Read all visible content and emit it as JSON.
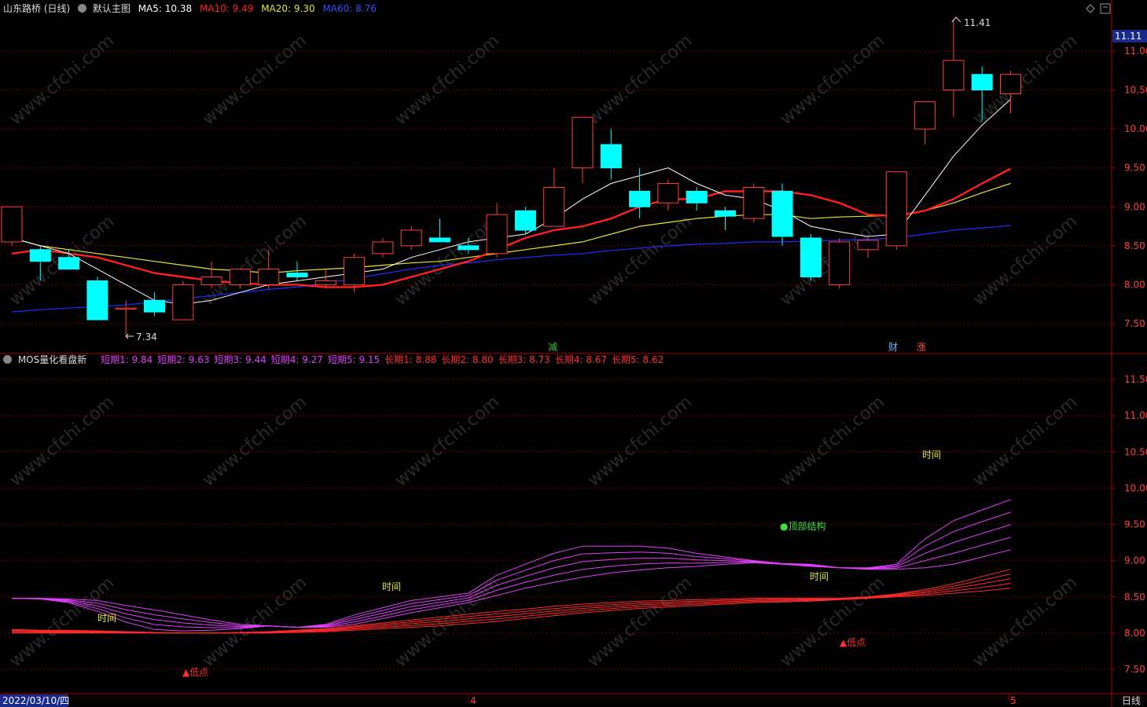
{
  "main_header": {
    "stock": "山东路桥 (日线)",
    "template": "默认主图",
    "ma5": "MA5: 10.38",
    "ma10": "MA10: 9.49",
    "ma20": "MA20: 9.30",
    "ma60": "MA60: 8.76"
  },
  "sub_header": {
    "title": "MOS量化看盘新",
    "values": [
      {
        "text": "短期1: 9.84",
        "color": "#e040fb"
      },
      {
        "text": "短期2: 9.63",
        "color": "#e040fb"
      },
      {
        "text": "短期3: 9.44",
        "color": "#e040fb"
      },
      {
        "text": "短期4: 9.27",
        "color": "#e040fb"
      },
      {
        "text": "短期5: 9.15",
        "color": "#e040fb"
      },
      {
        "text": "长期1: 8.88",
        "color": "#ff3030"
      },
      {
        "text": "长期2: 8.80",
        "color": "#ff3030"
      },
      {
        "text": "长期3: 8.73",
        "color": "#ff3030"
      },
      {
        "text": "长期4: 8.67",
        "color": "#ff3030"
      },
      {
        "text": "长期5: 8.62",
        "color": "#ff3030"
      }
    ]
  },
  "price_axis": {
    "current": "11.11",
    "ticks": [
      "11.00",
      "10.50",
      "10.00",
      "9.50",
      "9.00",
      "8.50",
      "8.00",
      "7.50"
    ]
  },
  "indicator_axis": {
    "ticks": [
      "11.50",
      "11.00",
      "10.50",
      "10.00",
      "9.50",
      "9.00",
      "8.50",
      "8.00",
      "7.50"
    ]
  },
  "annotations": {
    "high": "11.41",
    "low": "7.34",
    "jian": "减",
    "cai": "财",
    "zhang": "涨",
    "time_labels": [
      "时间",
      "时间",
      "时间",
      "时间"
    ],
    "top_structure": "●顶部结构",
    "low_point": "▲低点"
  },
  "x_axis": {
    "date": "2022/03/10/四",
    "month4": "4",
    "month5": "5",
    "period": "日线"
  },
  "watermark": "www.cfchi.com",
  "colors": {
    "up": "#ff4040",
    "down": "#00ffff",
    "ma5": "#ffffff",
    "ma10": "#ff2020",
    "ma20": "#e6e633",
    "ma60": "#2030ff",
    "short": "#e040fb",
    "long": "#ff2a2a",
    "grid": "#7a0000",
    "axis": "#b00000"
  },
  "chart_data": {
    "type": "candlestick",
    "price_range": [
      7.1,
      11.4
    ],
    "indicator_range": [
      7.25,
      11.85
    ],
    "candles": [
      {
        "o": 8.55,
        "h": 9.0,
        "l": 8.5,
        "c": 9.0
      },
      {
        "o": 8.45,
        "h": 8.5,
        "l": 8.05,
        "c": 8.3
      },
      {
        "o": 8.35,
        "h": 8.45,
        "l": 8.25,
        "c": 8.2
      },
      {
        "o": 8.05,
        "h": 8.1,
        "l": 7.55,
        "c": 7.55
      },
      {
        "o": 7.7,
        "h": 7.8,
        "l": 7.34,
        "c": 7.7
      },
      {
        "o": 7.8,
        "h": 7.9,
        "l": 7.6,
        "c": 7.65
      },
      {
        "o": 7.55,
        "h": 8.05,
        "l": 7.55,
        "c": 8.0
      },
      {
        "o": 8.0,
        "h": 8.3,
        "l": 7.95,
        "c": 8.1
      },
      {
        "o": 8.0,
        "h": 8.2,
        "l": 7.95,
        "c": 8.2
      },
      {
        "o": 8.0,
        "h": 8.45,
        "l": 7.95,
        "c": 8.2
      },
      {
        "o": 8.15,
        "h": 8.3,
        "l": 8.05,
        "c": 8.1
      },
      {
        "o": 8.0,
        "h": 8.2,
        "l": 7.95,
        "c": 8.05
      },
      {
        "o": 8.0,
        "h": 8.4,
        "l": 7.9,
        "c": 8.35
      },
      {
        "o": 8.4,
        "h": 8.6,
        "l": 8.35,
        "c": 8.55
      },
      {
        "o": 8.5,
        "h": 8.75,
        "l": 8.45,
        "c": 8.7
      },
      {
        "o": 8.6,
        "h": 8.85,
        "l": 8.55,
        "c": 8.55
      },
      {
        "o": 8.5,
        "h": 8.6,
        "l": 8.4,
        "c": 8.45
      },
      {
        "o": 8.4,
        "h": 9.05,
        "l": 8.35,
        "c": 8.9
      },
      {
        "o": 8.95,
        "h": 9.0,
        "l": 8.65,
        "c": 8.7
      },
      {
        "o": 8.75,
        "h": 9.5,
        "l": 8.75,
        "c": 9.25
      },
      {
        "o": 9.5,
        "h": 10.15,
        "l": 9.3,
        "c": 10.15
      },
      {
        "o": 9.8,
        "h": 10.0,
        "l": 9.35,
        "c": 9.5
      },
      {
        "o": 9.2,
        "h": 9.5,
        "l": 8.85,
        "c": 9.0
      },
      {
        "o": 9.05,
        "h": 9.35,
        "l": 8.95,
        "c": 9.3
      },
      {
        "o": 9.2,
        "h": 9.25,
        "l": 8.95,
        "c": 9.05
      },
      {
        "o": 8.95,
        "h": 9.0,
        "l": 8.7,
        "c": 8.88
      },
      {
        "o": 8.85,
        "h": 9.3,
        "l": 8.8,
        "c": 9.25
      },
      {
        "o": 9.2,
        "h": 9.3,
        "l": 8.5,
        "c": 8.62
      },
      {
        "o": 8.6,
        "h": 8.65,
        "l": 8.05,
        "c": 8.1
      },
      {
        "o": 8.0,
        "h": 8.6,
        "l": 7.95,
        "c": 8.55
      },
      {
        "o": 8.45,
        "h": 8.6,
        "l": 8.35,
        "c": 8.57
      },
      {
        "o": 8.5,
        "h": 9.45,
        "l": 8.45,
        "c": 9.45
      },
      {
        "o": 10.0,
        "h": 10.3,
        "l": 9.8,
        "c": 10.35
      },
      {
        "o": 10.5,
        "h": 11.41,
        "l": 10.15,
        "c": 10.88
      },
      {
        "o": 10.7,
        "h": 10.8,
        "l": 10.1,
        "c": 10.5
      },
      {
        "o": 10.45,
        "h": 10.75,
        "l": 10.2,
        "c": 10.7
      }
    ],
    "ma5": [
      8.6,
      8.5,
      8.4,
      8.2,
      8.0,
      7.8,
      7.75,
      7.8,
      7.9,
      8.0,
      8.05,
      8.1,
      8.15,
      8.2,
      8.35,
      8.45,
      8.55,
      8.6,
      8.65,
      8.85,
      9.1,
      9.3,
      9.4,
      9.5,
      9.3,
      9.15,
      9.1,
      8.95,
      8.75,
      8.68,
      8.62,
      8.65,
      9.15,
      9.65,
      10.05,
      10.38
    ],
    "ma10": [
      8.4,
      8.45,
      8.4,
      8.35,
      8.25,
      8.15,
      8.1,
      8.05,
      8.02,
      8.0,
      8.0,
      7.97,
      7.97,
      8.0,
      8.1,
      8.2,
      8.3,
      8.45,
      8.6,
      8.7,
      8.75,
      8.85,
      9.0,
      9.1,
      9.1,
      9.2,
      9.2,
      9.2,
      9.15,
      9.05,
      8.9,
      8.88,
      8.95,
      9.1,
      9.3,
      9.49
    ],
    "ma20": [
      8.6,
      8.5,
      8.45,
      8.4,
      8.35,
      8.3,
      8.25,
      8.2,
      8.18,
      8.15,
      8.18,
      8.2,
      8.22,
      8.25,
      8.28,
      8.3,
      8.35,
      8.4,
      8.45,
      8.5,
      8.55,
      8.65,
      8.75,
      8.8,
      8.85,
      8.88,
      8.9,
      8.9,
      8.85,
      8.87,
      8.88,
      8.89,
      8.95,
      9.05,
      9.18,
      9.3
    ],
    "ma60": [
      7.65,
      7.68,
      7.7,
      7.72,
      7.74,
      7.78,
      7.82,
      7.86,
      7.9,
      7.94,
      7.97,
      8.02,
      8.08,
      8.14,
      8.2,
      8.25,
      8.28,
      8.32,
      8.35,
      8.38,
      8.4,
      8.44,
      8.47,
      8.5,
      8.52,
      8.53,
      8.55,
      8.55,
      8.56,
      8.57,
      8.58,
      8.6,
      8.65,
      8.7,
      8.73,
      8.76
    ],
    "short_lines": {
      "short1": [
        8.48,
        8.47,
        8.42,
        8.3,
        8.15,
        8.05,
        8.03,
        8.04,
        8.06,
        8.1,
        8.08,
        8.12,
        8.25,
        8.35,
        8.45,
        8.5,
        8.55,
        8.8,
        8.95,
        9.1,
        9.2,
        9.2,
        9.2,
        9.17,
        9.1,
        9.05,
        9.0,
        8.96,
        8.95,
        8.9,
        8.9,
        8.95,
        9.3,
        9.55,
        9.7,
        9.84
      ],
      "short5": [
        8.48,
        8.48,
        8.47,
        8.45,
        8.38,
        8.32,
        8.25,
        8.18,
        8.12,
        8.1,
        8.08,
        8.08,
        8.12,
        8.2,
        8.28,
        8.35,
        8.42,
        8.52,
        8.62,
        8.7,
        8.77,
        8.83,
        8.87,
        8.9,
        8.92,
        8.95,
        8.97,
        8.95,
        8.92,
        8.9,
        8.88,
        8.88,
        8.9,
        8.95,
        9.05,
        9.15
      ]
    },
    "long_lines": {
      "long1": [
        8.05,
        8.04,
        8.04,
        8.03,
        8.02,
        8.01,
        8.0,
        8.0,
        8.01,
        8.02,
        8.04,
        8.06,
        8.1,
        8.14,
        8.18,
        8.22,
        8.26,
        8.3,
        8.33,
        8.37,
        8.4,
        8.42,
        8.44,
        8.45,
        8.46,
        8.47,
        8.48,
        8.48,
        8.48,
        8.48,
        8.5,
        8.54,
        8.6,
        8.68,
        8.78,
        8.88
      ],
      "long5": [
        8.0,
        8.0,
        8.0,
        8.0,
        8.0,
        8.0,
        8.0,
        8.0,
        8.0,
        8.0,
        8.01,
        8.02,
        8.04,
        8.06,
        8.08,
        8.1,
        8.13,
        8.16,
        8.2,
        8.24,
        8.28,
        8.31,
        8.34,
        8.36,
        8.38,
        8.4,
        8.42,
        8.43,
        8.44,
        8.46,
        8.48,
        8.5,
        8.52,
        8.55,
        8.58,
        8.62
      ]
    }
  }
}
